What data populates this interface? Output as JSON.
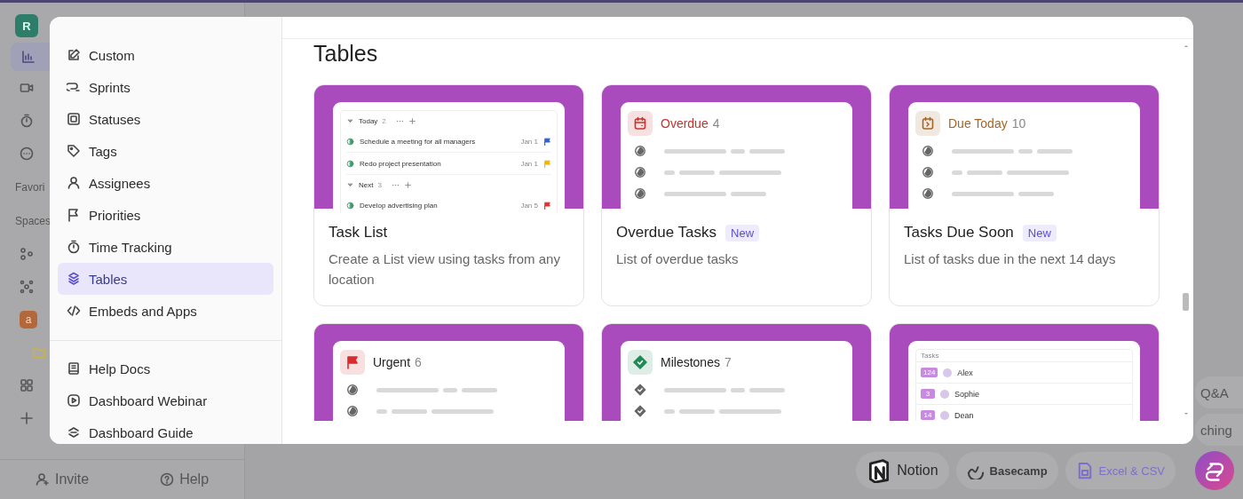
{
  "app_sidebar": {
    "workspace_avatar": "R",
    "sections": [
      {
        "label": "Favori"
      },
      {
        "label": "Spaces"
      }
    ],
    "space_avatar": "a",
    "footer": [
      {
        "label": "Invite"
      },
      {
        "label": "Help"
      }
    ]
  },
  "side_chips": [
    "Q&A",
    "ching"
  ],
  "import_buttons": [
    {
      "label": "Notion",
      "kind": "notion"
    },
    {
      "label": "Basecamp",
      "kind": "basecamp"
    },
    {
      "label": "Excel & CSV",
      "kind": "excel"
    }
  ],
  "modal": {
    "nav": {
      "items": [
        {
          "label": "Custom",
          "selected": false
        },
        {
          "label": "Sprints",
          "selected": false
        },
        {
          "label": "Statuses",
          "selected": false
        },
        {
          "label": "Tags",
          "selected": false
        },
        {
          "label": "Assignees",
          "selected": false
        },
        {
          "label": "Priorities",
          "selected": false
        },
        {
          "label": "Time Tracking",
          "selected": false
        },
        {
          "label": "Tables",
          "selected": true
        },
        {
          "label": "Embeds and Apps",
          "selected": false
        }
      ],
      "help_links": [
        {
          "label": "Help Docs"
        },
        {
          "label": "Dashboard Webinar"
        },
        {
          "label": "Dashboard Guide"
        }
      ]
    },
    "section_title": "Tables",
    "cards": [
      {
        "title": "Task List",
        "description": "Create a List view using tasks from any location",
        "preview": {
          "kind": "task_list",
          "groups": [
            {
              "name": "Today",
              "count": "2",
              "tasks": [
                {
                  "name": "Schedule a meeting for all managers",
                  "date": "Jan 1",
                  "color": "#2f5fd0"
                },
                {
                  "name": "Redo project presentation",
                  "date": "Jan 1",
                  "color": "#f2b400"
                }
              ]
            },
            {
              "name": "Next",
              "count": "3",
              "tasks": [
                {
                  "name": "Develop advertising plan",
                  "date": "Jan 5",
                  "color": "#e03131"
                }
              ]
            }
          ]
        }
      },
      {
        "title": "Overdue Tasks",
        "badge": "New",
        "description": "List of overdue tasks",
        "preview": {
          "kind": "group",
          "color": "#c9302c",
          "label": "Overdue",
          "count": "4"
        }
      },
      {
        "title": "Tasks Due Soon",
        "badge": "New",
        "description": "List of tasks due in the next 14 days",
        "preview": {
          "kind": "group",
          "color": "#a3662a",
          "label": "Due Today",
          "count": "10"
        }
      },
      {
        "preview": {
          "kind": "group",
          "color": "#d92d2d",
          "label": "Urgent",
          "count": "6"
        }
      },
      {
        "preview": {
          "kind": "group",
          "color": "#1f8a55",
          "label": "Milestones",
          "count": "7"
        }
      },
      {
        "preview": {
          "kind": "table",
          "title": "Tasks",
          "rows": [
            {
              "tag": "124",
              "name": "Alex"
            },
            {
              "tag": "3",
              "name": "Sophie"
            },
            {
              "tag": "14",
              "name": "Dean"
            }
          ]
        }
      }
    ]
  }
}
